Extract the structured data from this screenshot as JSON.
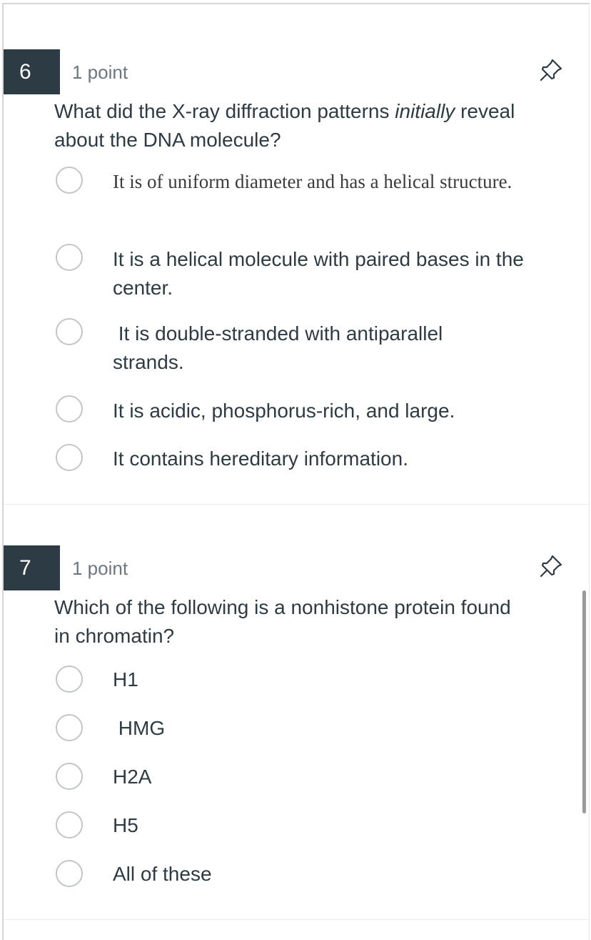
{
  "questions": [
    {
      "number": "6",
      "points": "1 point",
      "prompt_before": "What did the X-ray diffraction patterns ",
      "prompt_emphasis": "initially",
      "prompt_after": " reveal about the DNA molecule?",
      "options": [
        "It is of uniform diameter and has a helical structure.",
        "It is a helical molecule with paired bases in the center.",
        " It is double-stranded with antiparallel strands.",
        "It is acidic, phosphorus-rich, and large.",
        "It contains hereditary information."
      ]
    },
    {
      "number": "7",
      "points": "1 point",
      "prompt": "Which of the following is a nonhistone protein found in chromatin?",
      "options": [
        "H1",
        " HMG",
        "H2A",
        "H5",
        "All of these"
      ]
    }
  ],
  "icons": {
    "pin": "pushpin-icon"
  },
  "colors": {
    "number_badge": "#2d3b45",
    "text": "#2d3b45",
    "points": "#6b7780",
    "radio_border": "#c2c6c9"
  }
}
